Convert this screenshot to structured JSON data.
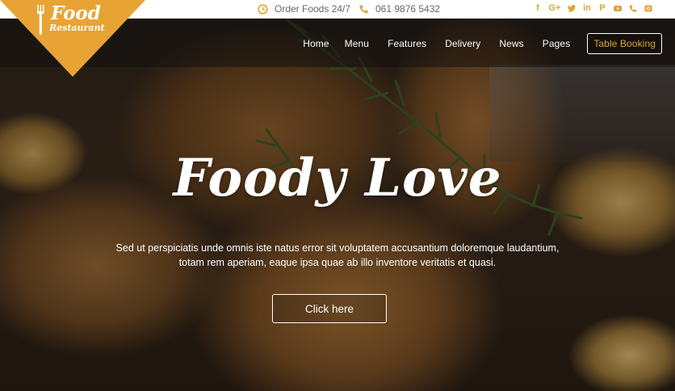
{
  "brand": {
    "logo_line1": "Food",
    "logo_line2": "Restaurant",
    "accent_color": "#e8a335"
  },
  "topbar": {
    "hours_text": "Order Foods 24/7",
    "phone_text": "061 9876 5432",
    "social_icons": [
      "facebook-icon",
      "google-plus-icon",
      "twitter-icon",
      "linkedin-icon",
      "pinterest-icon",
      "youtube-icon",
      "phone-icon",
      "instagram-icon"
    ]
  },
  "nav": {
    "items": [
      "Home",
      "Menu",
      "Features",
      "Delivery",
      "News",
      "Pages"
    ],
    "booking_label": "Table Booking"
  },
  "hero": {
    "headline": "Foody Love",
    "description": "Sed ut perspiciatis unde omnis iste natus error sit voluptatem accusantium doloremque laudantium, totam rem aperiam, eaque ipsa quae ab illo inventore veritatis et quasi.",
    "cta_label": "Click here"
  }
}
